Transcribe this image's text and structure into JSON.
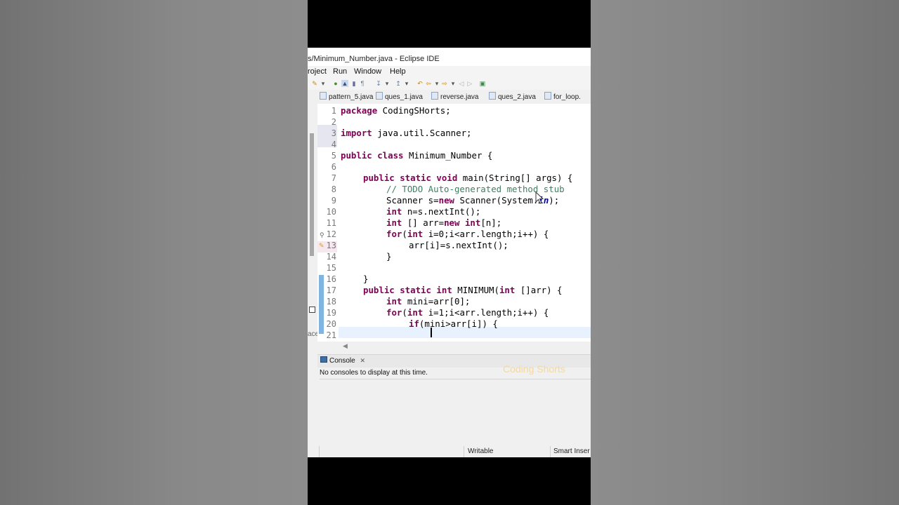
{
  "window": {
    "title": "s/Minimum_Number.java - Eclipse IDE"
  },
  "menu": {
    "items": [
      "roject",
      "Run",
      "Window",
      "Help"
    ]
  },
  "tabs": [
    "pattern_5.java",
    "ques_1.java",
    "reverse.java",
    "ques_2.java",
    "for_loop."
  ],
  "editor": {
    "line_numbers": [
      "1",
      "2",
      "3",
      "4",
      "5",
      "6",
      "7",
      "8",
      "9",
      "10",
      "11",
      "12",
      "13",
      "14",
      "15",
      "16",
      "17",
      "18",
      "19",
      "20",
      "21"
    ],
    "line1": {
      "kw": "package",
      "rest": " CodingSHorts;"
    },
    "line3": {
      "kw": "import",
      "rest": " java.util.Scanner;"
    },
    "line5": {
      "kw": "public class",
      "rest": " Minimum_Number {"
    },
    "line7": {
      "kw": "public static void",
      "rest": " main(String[] args) {"
    },
    "line8": {
      "comment": "// TODO Auto-generated method stub"
    },
    "line9": {
      "a": "Scanner s=",
      "kw": "new",
      "b": " Scanner(System.",
      "field": "in",
      "c": ");"
    },
    "line10": {
      "kw": "int",
      "rest": " n=s.nextInt();"
    },
    "line11": {
      "kw1": "int",
      "a": " [] arr=",
      "kw2": "new",
      "b": " ",
      "kw3": "int",
      "c": "[n];"
    },
    "line12": {
      "kw1": "for",
      "a": "(",
      "kw2": "int",
      "b": " i=0;i<arr.length;i++) {"
    },
    "line13": {
      "text": "arr[i]=s.nextInt();"
    },
    "line14": {
      "text": "}"
    },
    "line16": {
      "text": "}"
    },
    "line17": {
      "kw1": "public static int",
      "a": " MINIMUM(",
      "kw2": "int",
      "b": " []arr) {"
    },
    "line18": {
      "kw": "int",
      "rest": " mini=arr[0];"
    },
    "line19": {
      "kw1": "for",
      "a": "(",
      "kw2": "int",
      "b": " i=1;i<arr.length;i++) {"
    },
    "line20": {
      "kw": "if",
      "rest": "(mini>arr[i]) {"
    }
  },
  "left_label": "ace",
  "console": {
    "tab_label": "Console",
    "close": "✕",
    "message": "No consoles to display at this time."
  },
  "status": {
    "writable": "Writable",
    "insert_mode": "Smart Inser"
  },
  "watermark": "Coding Shorts",
  "colors": {
    "keyword": "#7f0055",
    "comment": "#3f7f5f",
    "field": "#0000c0",
    "current_line": "#e8f2fe"
  }
}
